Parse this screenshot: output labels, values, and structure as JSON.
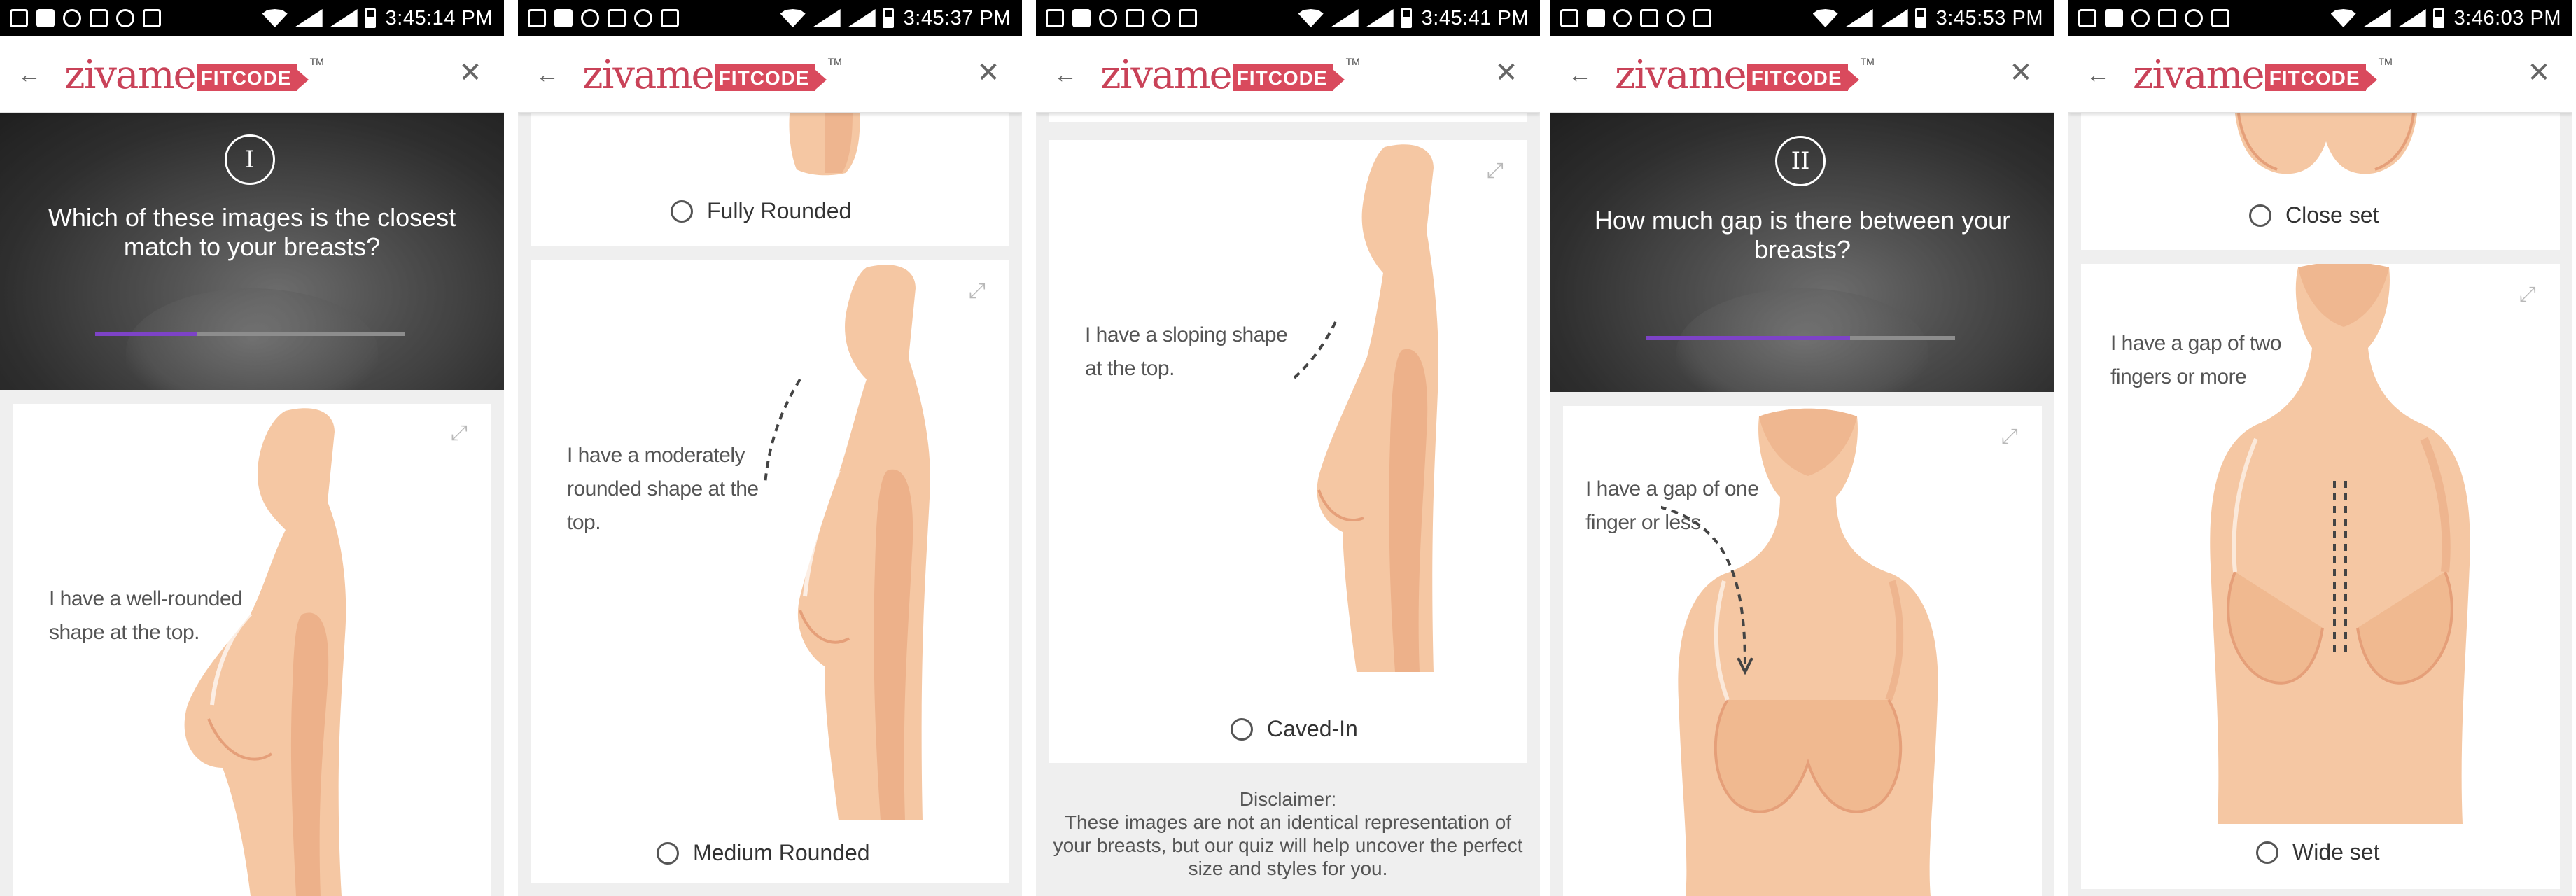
{
  "app": {
    "logo_text": "zivame",
    "logo_badge": "FITCODE",
    "logo_tm": "TM",
    "back_icon": "arrow-left-icon",
    "close_icon": "close-icon"
  },
  "screens": [
    {
      "time": "3:45:14 PM",
      "step_numeral": "I",
      "question": "Which of these images is the closest match to your breasts?",
      "progress": 0.33,
      "caption": "I have a well-rounded shape at the top."
    },
    {
      "time": "3:45:37 PM",
      "top_option": "Fully Rounded",
      "caption": "I have a moderately rounded shape at the top.",
      "bottom_option": "Medium Rounded"
    },
    {
      "time": "3:45:41 PM",
      "caption": "I have a sloping shape at the top.",
      "option": "Caved-In",
      "disclaimer_title": "Disclaimer:",
      "disclaimer_text": "These images are not an identical representation of your breasts, but our quiz will help uncover the perfect size and styles for you."
    },
    {
      "time": "3:45:53 PM",
      "step_numeral": "II",
      "question": "How much gap is there between your breasts?",
      "progress": 0.66,
      "caption": "I have a gap of one finger or less"
    },
    {
      "time": "3:46:03 PM",
      "top_option": "Close set",
      "caption": "I have a gap of two fingers or more",
      "bottom_option": "Wide set"
    }
  ],
  "colors": {
    "brand": "#c94258",
    "progress": "#7d43c7",
    "skin": "#f5c7a3",
    "skin_shadow": "#eaa982"
  }
}
